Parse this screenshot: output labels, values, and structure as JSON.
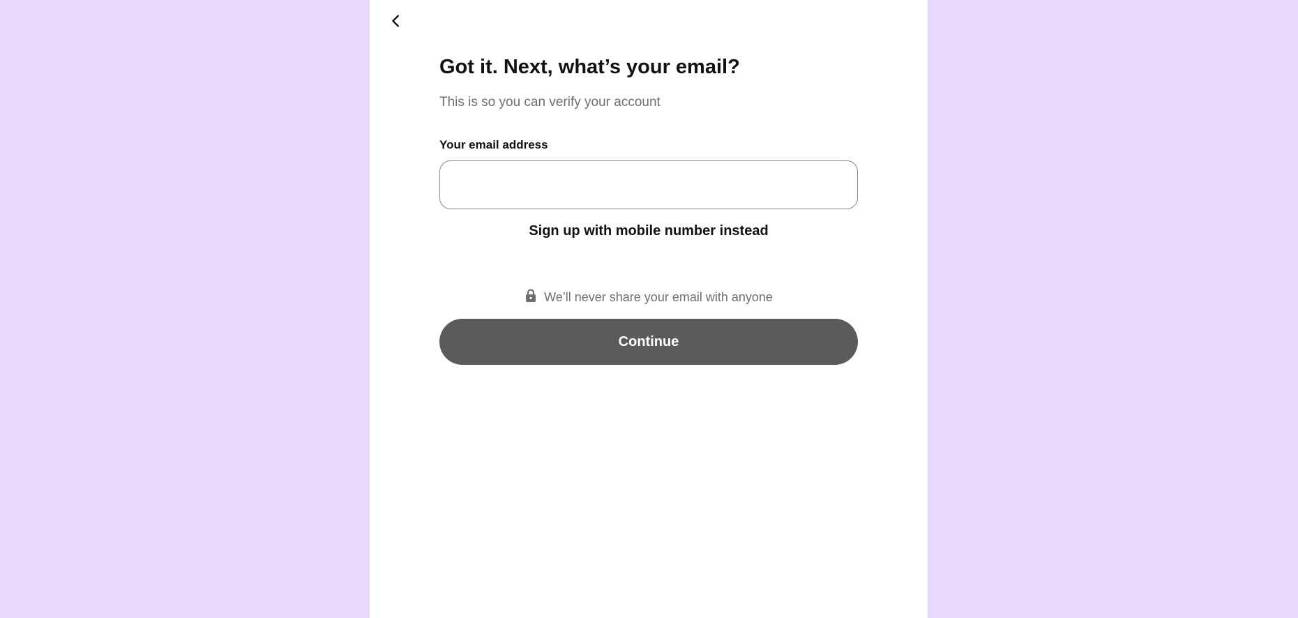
{
  "header": {
    "back_icon": "chevron-left-icon"
  },
  "form": {
    "title": "Got it. Next, what’s your email?",
    "subtitle": "This is so you can verify your account",
    "email_label": "Your email address",
    "email_value": "",
    "email_placeholder": "",
    "alt_signup_label": "Sign up with mobile number instead",
    "privacy_icon": "lock-icon",
    "privacy_text": "We’ll never share your email with anyone",
    "continue_label": "Continue"
  },
  "colors": {
    "page_background": "#e8d9fc",
    "panel_background": "#ffffff",
    "continue_button": "#5b5b5b",
    "text_primary": "#121212",
    "text_secondary": "#6f6f6f"
  }
}
